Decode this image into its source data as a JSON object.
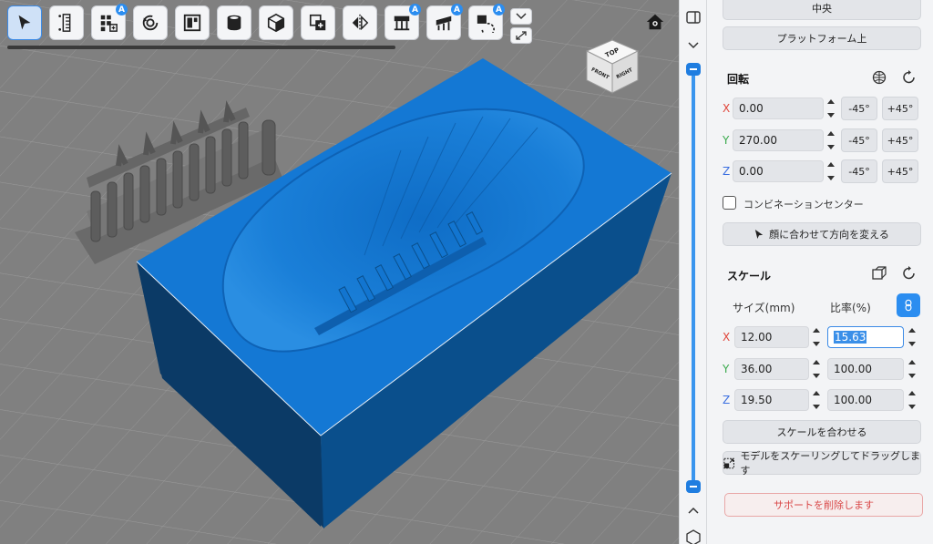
{
  "toolbar": {
    "tools": [
      {
        "name": "select-tool",
        "active": true
      },
      {
        "name": "measure-tool"
      },
      {
        "name": "auto-arrange-tool",
        "badge": "A"
      },
      {
        "name": "rotate-tool"
      },
      {
        "name": "layout-tool"
      },
      {
        "name": "hollow-tool"
      },
      {
        "name": "cube-tool"
      },
      {
        "name": "duplicate-tool"
      },
      {
        "name": "mirror-tool"
      },
      {
        "name": "auto-support-tool",
        "badge": "A"
      },
      {
        "name": "support-tool",
        "badge": "A"
      },
      {
        "name": "auto-orient-tool",
        "badge": "A"
      }
    ]
  },
  "nav_cube": {
    "top": "TOP",
    "front": "FRONT",
    "right": "RIGHT"
  },
  "panel": {
    "center_button": "中央",
    "on_platform_button": "プラットフォーム上",
    "rotation": {
      "title": "回転",
      "x": "0.00",
      "y": "270.00",
      "z": "0.00",
      "minus45": "-45°",
      "plus45": "+45°"
    },
    "combination_center_label": "コンビネーションセンター",
    "orient_to_face_button": "顔に合わせて方向を変える",
    "scale": {
      "title": "スケール",
      "size_header": "サイズ(mm)",
      "ratio_header": "比率(%)",
      "x_size": "12.00",
      "y_size": "36.00",
      "z_size": "19.50",
      "x_ratio": "15.63",
      "y_ratio": "100.00",
      "z_ratio": "100.00"
    },
    "fit_scale_button": "スケールを合わせる",
    "drag_scale_button": "モデルをスケーリングしてドラッグします",
    "remove_support_button": "サポートを削除します"
  },
  "axes": {
    "x": "X",
    "y": "Y",
    "z": "Z"
  },
  "colors": {
    "accent": "#2b8df0",
    "model_top": "#1478d4",
    "model_front": "#0b3a66",
    "model_side": "#0a4f8c",
    "danger": "#d94848"
  }
}
